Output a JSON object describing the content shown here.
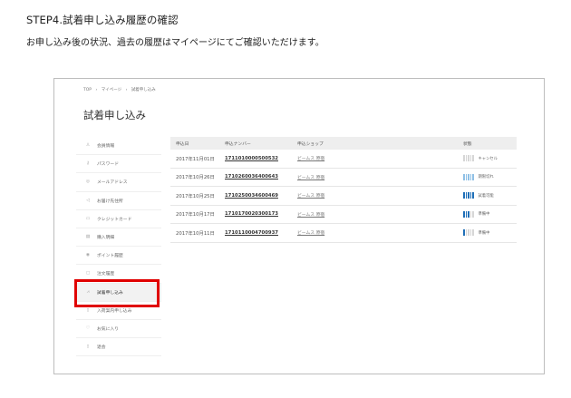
{
  "step": {
    "heading": "STEP4.試着申し込み履歴の確認",
    "description": "お申し込み後の状況、過去の履歴はマイページにてご確認いただけます。"
  },
  "breadcrumb": [
    "TOP",
    "›",
    "マイページ",
    "›",
    "試着申し込み"
  ],
  "page_title": "試着申し込み",
  "sidebar": {
    "items": [
      {
        "label": "会員情報",
        "icon": "person-icon",
        "glyph": "♙"
      },
      {
        "label": "パスワード",
        "icon": "key-icon",
        "glyph": "⚷"
      },
      {
        "label": "メールアドレス",
        "icon": "mail-icon",
        "glyph": "◎"
      },
      {
        "label": "お届け先住所",
        "icon": "send-icon",
        "glyph": "◁"
      },
      {
        "label": "クレジットカード",
        "icon": "credit-card-icon",
        "glyph": "▭"
      },
      {
        "label": "購入明細",
        "icon": "receipt-icon",
        "glyph": "▤"
      },
      {
        "label": "ポイント履歴",
        "icon": "point-icon",
        "glyph": "◉"
      },
      {
        "label": "注文履歴",
        "icon": "history-icon",
        "glyph": "▢"
      },
      {
        "label": "試着申し込み",
        "icon": "hanger-icon",
        "glyph": "⩘",
        "active": true
      },
      {
        "label": "入荷案内申し込み",
        "icon": "notice-icon",
        "glyph": "▯"
      },
      {
        "label": "お気に入り",
        "icon": "heart-icon",
        "glyph": "♡"
      },
      {
        "label": "退会",
        "icon": "exit-icon",
        "glyph": "▯"
      }
    ]
  },
  "table": {
    "headers": {
      "date": "申込日",
      "number": "申込ナンバー",
      "shop": "申込ショップ",
      "status": "状態"
    },
    "rows": [
      {
        "date": "2017年11月01日",
        "number": "1711010000500532",
        "shop": "ビームス 原宿",
        "status": "キャンセル",
        "progress": 0,
        "accent": "#3a8ed0"
      },
      {
        "date": "2017年10月26日",
        "number": "1710260036400643",
        "shop": "ビームス 原宿",
        "status": "期限切れ",
        "progress": 5,
        "accent": "#8fc0e6"
      },
      {
        "date": "2017年10月25日",
        "number": "1710250034600469",
        "shop": "ビームス 原宿",
        "status": "試着可能",
        "progress": 5,
        "accent": "#1f6fb8"
      },
      {
        "date": "2017年10月17日",
        "number": "1710170020300173",
        "shop": "ビームス 原宿",
        "status": "準備中",
        "progress": 3,
        "accent": "#1f6fb8"
      },
      {
        "date": "2017年10月11日",
        "number": "1710110004700937",
        "shop": "ビームス 原宿",
        "status": "準備中",
        "progress": 1,
        "accent": "#1f6fb8"
      }
    ]
  },
  "colors": {
    "highlight": "#e00000",
    "progress_on": "#3a8ed0",
    "progress_off": "#d6d6d6"
  }
}
